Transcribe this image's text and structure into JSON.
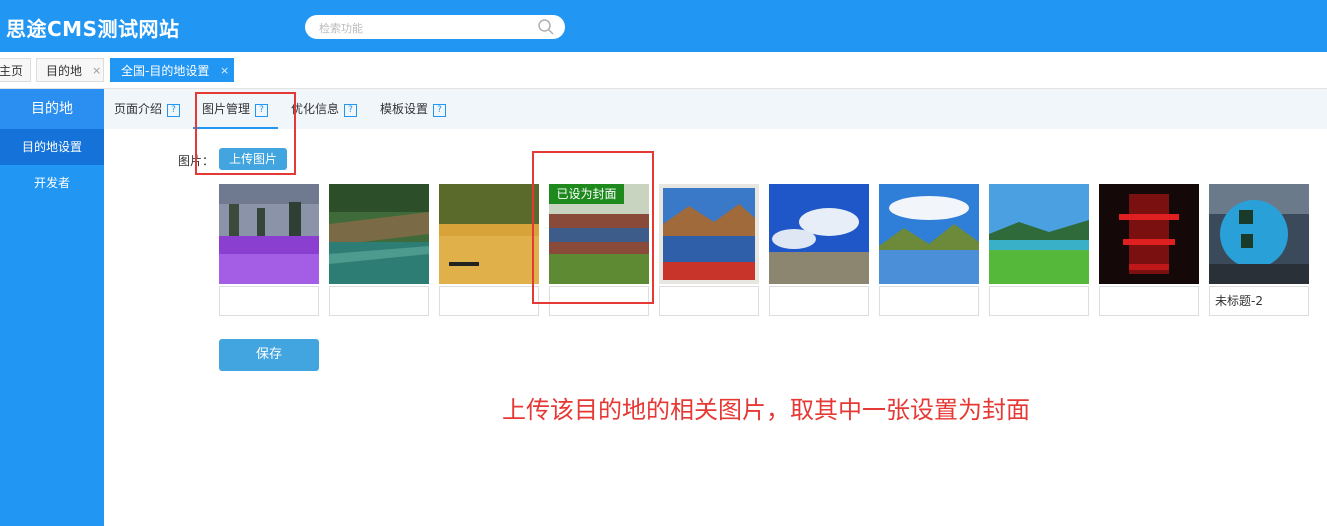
{
  "header": {
    "brand": "思途CMS测试网站",
    "search_placeholder": "检索功能"
  },
  "tabs": [
    {
      "label": "主页",
      "closable": false,
      "active": false
    },
    {
      "label": "目的地",
      "closable": true,
      "active": false,
      "close": "×"
    },
    {
      "label": "全国-目的地设置",
      "closable": true,
      "active": true,
      "close": "×"
    }
  ],
  "sidebar": {
    "title": "目的地",
    "items": [
      {
        "label": "目的地设置",
        "active": true
      },
      {
        "label": "开发者",
        "active": false
      }
    ]
  },
  "subtabs": [
    {
      "label": "页面介绍",
      "help": "?"
    },
    {
      "label": "图片管理",
      "help": "?",
      "active": true
    },
    {
      "label": "优化信息",
      "help": "?"
    },
    {
      "label": "模板设置",
      "help": "?"
    }
  ],
  "form": {
    "image_label": "图片：",
    "upload_label": "上传图片",
    "save_label": "保存",
    "cover_badge": "已设为封面"
  },
  "images": [
    {
      "scene": "lavender-field",
      "caption": ""
    },
    {
      "scene": "terraced-river",
      "caption": ""
    },
    {
      "scene": "sunset-lake-boat",
      "caption": ""
    },
    {
      "scene": "crowd-festival",
      "caption": "",
      "is_cover": true
    },
    {
      "scene": "mountain-lake-reflection",
      "caption": ""
    },
    {
      "scene": "blue-sky-rocks",
      "caption": ""
    },
    {
      "scene": "mountain-lake-clouds",
      "caption": ""
    },
    {
      "scene": "green-lake-meadow",
      "caption": ""
    },
    {
      "scene": "red-night-tower",
      "caption": ""
    },
    {
      "scene": "tea-package",
      "caption": "未标题-2"
    }
  ],
  "annotation": {
    "text": "上传该目的地的相关图片，取其中一张设置为封面",
    "color": "#e53935"
  },
  "colors": {
    "brand_blue": "#2196f3",
    "button_blue": "#42a5e0",
    "badge_green": "#1e8a1e"
  }
}
